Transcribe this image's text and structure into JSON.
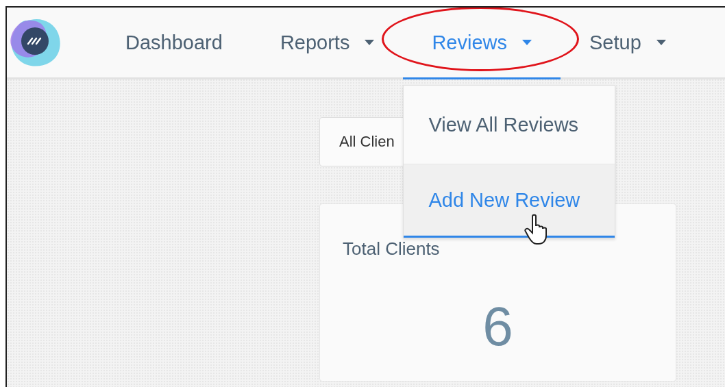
{
  "nav": {
    "items": [
      {
        "label": "Dashboard",
        "has_menu": false,
        "selected": false
      },
      {
        "label": "Reports",
        "has_menu": true,
        "selected": false
      },
      {
        "label": "Reviews",
        "has_menu": true,
        "selected": true
      },
      {
        "label": "Setup",
        "has_menu": true,
        "selected": false
      }
    ]
  },
  "dropdown": {
    "items": [
      {
        "label": "View All Reviews",
        "selected": false
      },
      {
        "label": "Add New Review",
        "selected": true
      }
    ]
  },
  "client_select": {
    "value": "All Clien"
  },
  "card": {
    "title": "Total Clients",
    "value": "6"
  }
}
